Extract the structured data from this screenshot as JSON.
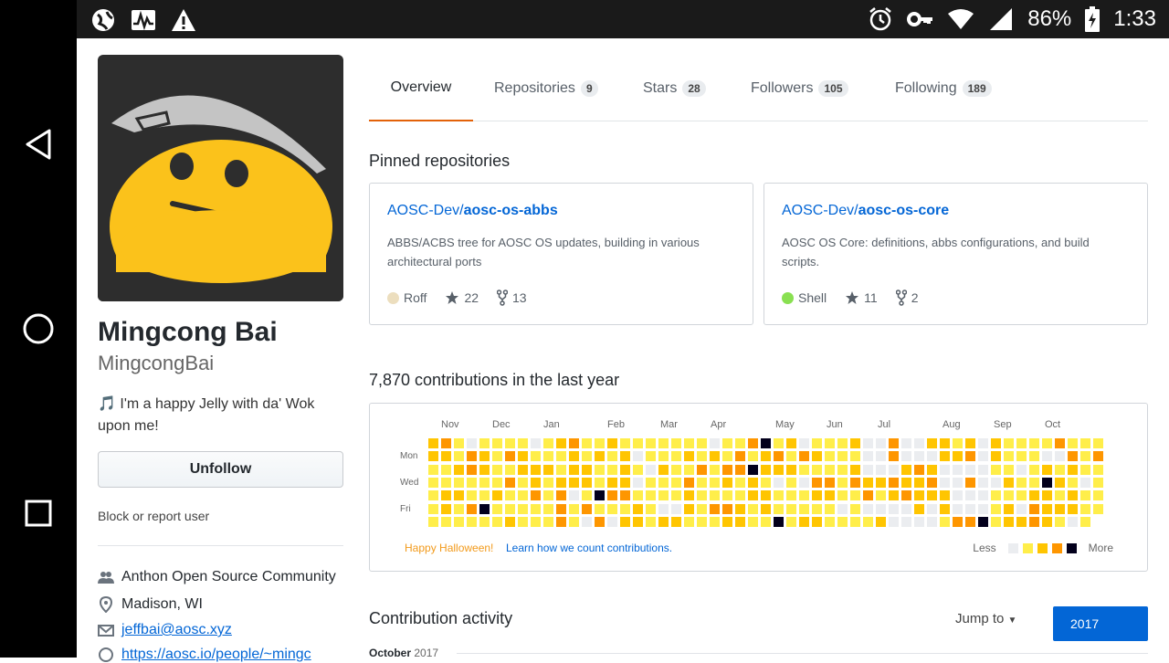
{
  "status_bar": {
    "battery": "86%",
    "time": "1:33",
    "icons_left": [
      "globe-icon",
      "activity-icon",
      "warning-icon"
    ],
    "icons_right": [
      "alarm-icon",
      "key-icon",
      "wifi-icon",
      "signal-icon",
      "battery-charging-icon"
    ]
  },
  "nav_bar": [
    "back-icon",
    "home-icon",
    "recents-icon"
  ],
  "profile": {
    "full_name": "Mingcong Bai",
    "username": "MingcongBai",
    "bio": "🎵 I'm a happy Jelly with da' Wok upon me!",
    "unfollow_label": "Unfollow",
    "block_label": "Block or report user",
    "organization": "Anthon Open Source Community",
    "location": "Madison, WI",
    "email": "jeffbai@aosc.xyz",
    "website": "https://aosc.io/people/~mingc"
  },
  "tabs": [
    {
      "label": "Overview",
      "count": ""
    },
    {
      "label": "Repositories",
      "count": "9"
    },
    {
      "label": "Stars",
      "count": "28"
    },
    {
      "label": "Followers",
      "count": "105"
    },
    {
      "label": "Following",
      "count": "189"
    }
  ],
  "pinned": {
    "heading": "Pinned repositories",
    "repos": [
      {
        "owner": "AOSC-Dev/",
        "name": "aosc-os-abbs",
        "description": "ABBS/ACBS tree for AOSC OS updates, building in various architectural ports",
        "language": "Roff",
        "lang_color": "#ecdebe",
        "stars": "22",
        "forks": "13"
      },
      {
        "owner": "AOSC-Dev/",
        "name": "aosc-os-core",
        "description": "AOSC OS Core: definitions, abbs configurations, and build scripts.",
        "language": "Shell",
        "lang_color": "#89e051",
        "stars": "11",
        "forks": "2"
      }
    ]
  },
  "contributions": {
    "heading": "7,870 contributions in the last year",
    "months": [
      "Nov",
      "Dec",
      "Jan",
      "Feb",
      "Mar",
      "Apr",
      "May",
      "Jun",
      "Jul",
      "Aug",
      "Sep",
      "Oct"
    ],
    "days": [
      "Mon",
      "Wed",
      "Fri"
    ],
    "halloween": "Happy Halloween!",
    "learn": "Learn how we count contributions.",
    "less": "Less",
    "more": "More",
    "colors": [
      "#ebedf0",
      "#ffee4a",
      "#ffc501",
      "#fe9600",
      "#03001c"
    ]
  },
  "activity": {
    "heading": "Contribution activity",
    "jump_to": "Jump to",
    "year": "2017",
    "period_month": "October",
    "period_year": "2017"
  }
}
